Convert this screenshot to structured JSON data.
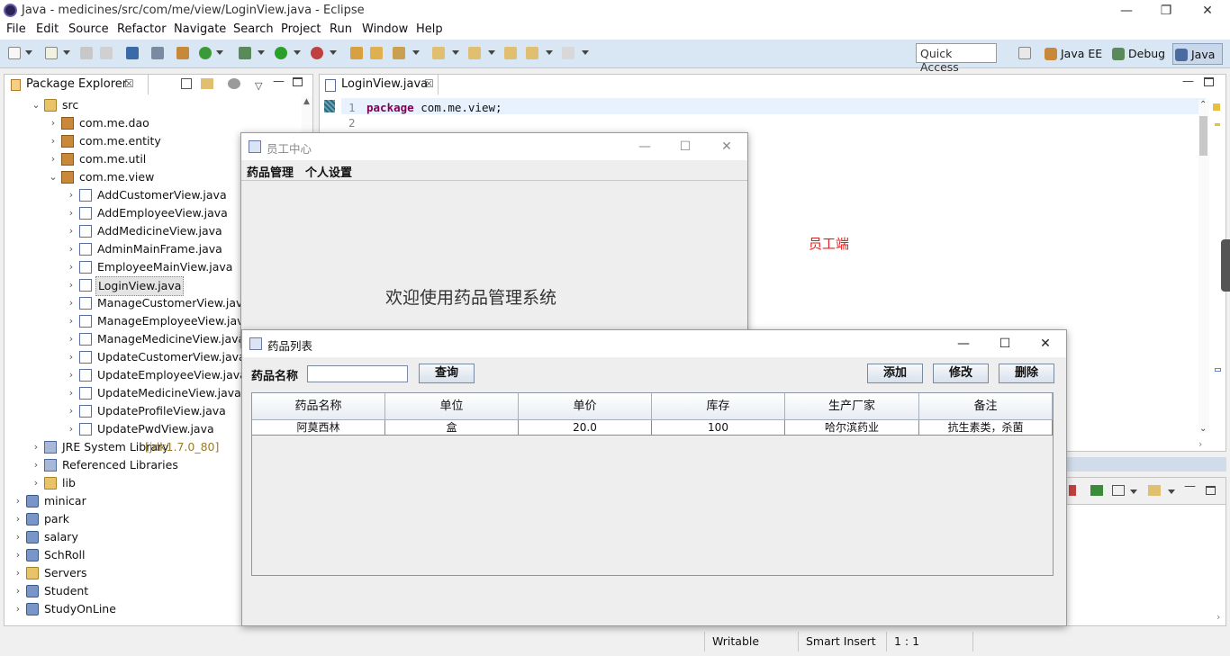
{
  "window": {
    "title": "Java - medicines/src/com/me/view/LoginView.java - Eclipse",
    "minimize": "—",
    "restore": "❐",
    "close": "✕"
  },
  "menu": [
    "File",
    "Edit",
    "Source",
    "Refactor",
    "Navigate",
    "Search",
    "Project",
    "Run",
    "Window",
    "Help"
  ],
  "toolbar": {
    "quick_access": "Quick Access",
    "perspectives": [
      "Java EE",
      "Debug",
      "Java"
    ]
  },
  "package_explorer": {
    "tab_label": "Package Explorer",
    "tab_close": "☒",
    "items": [
      {
        "label": "src",
        "icon": "folder-icon",
        "expanded": true
      },
      {
        "label": "com.me.dao",
        "icon": "package-icon"
      },
      {
        "label": "com.me.entity",
        "icon": "package-icon"
      },
      {
        "label": "com.me.util",
        "icon": "package-icon"
      },
      {
        "label": "com.me.view",
        "icon": "package-icon",
        "expanded": true
      },
      {
        "label": "AddCustomerView.java",
        "icon": "java-file-icon"
      },
      {
        "label": "AddEmployeeView.java",
        "icon": "java-file-icon"
      },
      {
        "label": "AddMedicineView.java",
        "icon": "java-file-icon"
      },
      {
        "label": "AdminMainFrame.java",
        "icon": "java-file-icon"
      },
      {
        "label": "EmployeeMainView.java",
        "icon": "java-file-icon"
      },
      {
        "label": "LoginView.java",
        "icon": "java-file-icon",
        "selected": true
      },
      {
        "label": "ManageCustomerView.java",
        "icon": "java-file-icon"
      },
      {
        "label": "ManageEmployeeView.java",
        "icon": "java-file-icon"
      },
      {
        "label": "ManageMedicineView.java",
        "icon": "java-file-icon"
      },
      {
        "label": "UpdateCustomerView.java",
        "icon": "java-file-icon"
      },
      {
        "label": "UpdateEmployeeView.java",
        "icon": "java-file-icon"
      },
      {
        "label": "UpdateMedicineView.java",
        "icon": "java-file-icon"
      },
      {
        "label": "UpdateProfileView.java",
        "icon": "java-file-icon"
      },
      {
        "label": "UpdatePwdView.java",
        "icon": "java-file-icon"
      },
      {
        "label": "JRE System Library",
        "suffix": "[jdk1.7.0_80]",
        "icon": "library-icon"
      },
      {
        "label": "Referenced Libraries",
        "icon": "library-icon"
      },
      {
        "label": "lib",
        "icon": "folder-icon"
      },
      {
        "label": "minicar",
        "icon": "project-icon"
      },
      {
        "label": "park",
        "icon": "project-icon"
      },
      {
        "label": "salary",
        "icon": "project-icon"
      },
      {
        "label": "SchRoll",
        "icon": "project-icon"
      },
      {
        "label": "Servers",
        "icon": "folder-icon"
      },
      {
        "label": "Student",
        "icon": "project-icon"
      },
      {
        "label": "StudyOnLine",
        "icon": "project-icon"
      }
    ]
  },
  "editor": {
    "tab_label": "LoginView.java",
    "tab_close": "☒",
    "lines": [
      {
        "num": "1",
        "keyword": "package",
        "text": " com.me.view;"
      },
      {
        "num": "2",
        "keyword": "",
        "text": ""
      }
    ],
    "annotation": "员工端"
  },
  "status_bar": {
    "writable": "Writable",
    "insert_mode": "Smart Insert",
    "position": "1 : 1"
  },
  "employee_center": {
    "title": "员工中心",
    "menus": [
      "药品管理",
      "个人设置"
    ],
    "welcome": "欢迎使用药品管理系统",
    "minimize": "—",
    "maximize": "☐",
    "close": "✕"
  },
  "medicine_list": {
    "title": "药品列表",
    "search_label": "药品名称",
    "search_value": "",
    "query_button": "查询",
    "add_button": "添加",
    "edit_button": "修改",
    "delete_button": "删除",
    "minimize": "—",
    "maximize": "☐",
    "close": "✕",
    "columns": [
      "药品名称",
      "单位",
      "单价",
      "库存",
      "生产厂家",
      "备注"
    ],
    "rows": [
      [
        "阿莫西林",
        "盒",
        "20.0",
        "100",
        "哈尔滨药业",
        "抗生素类，杀菌"
      ]
    ]
  }
}
